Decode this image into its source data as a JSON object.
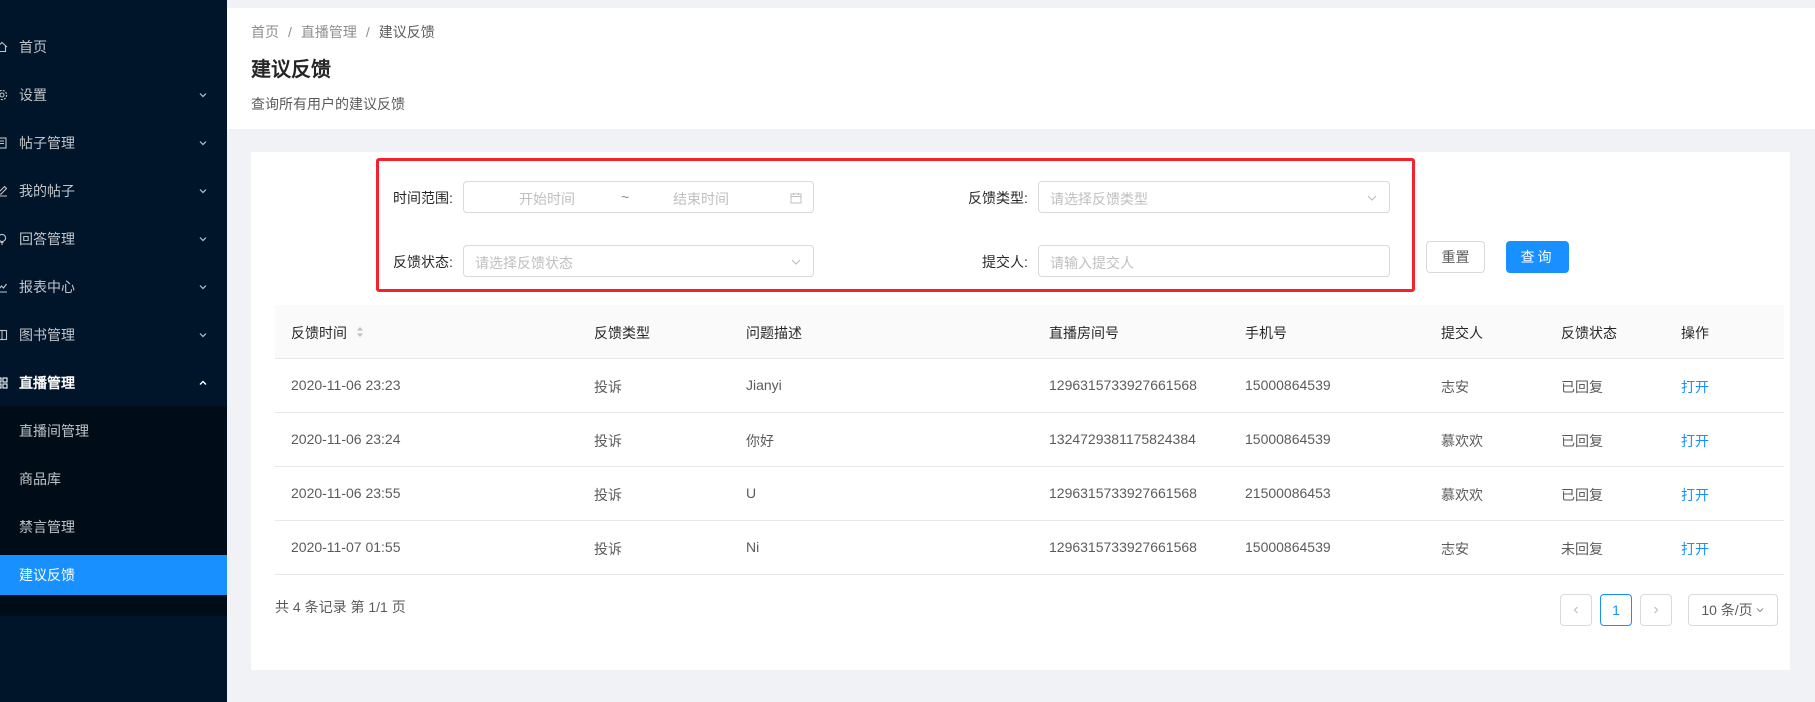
{
  "sidebar": {
    "items": [
      {
        "label": "首页",
        "icon": "home-icon"
      },
      {
        "label": "设置",
        "icon": "gear-icon"
      },
      {
        "label": "帖子管理",
        "icon": "file-icon"
      },
      {
        "label": "我的帖子",
        "icon": "edit-icon"
      },
      {
        "label": "回答管理",
        "icon": "bulb-icon"
      },
      {
        "label": "报表中心",
        "icon": "line-chart-icon"
      },
      {
        "label": "图书管理",
        "icon": "book-icon"
      },
      {
        "label": "直播管理",
        "icon": "appstore-icon"
      }
    ],
    "subitems": [
      {
        "label": "直播间管理"
      },
      {
        "label": "商品库"
      },
      {
        "label": "禁言管理"
      },
      {
        "label": "建议反馈"
      }
    ]
  },
  "header": {
    "breadcrumb": [
      "首页",
      "直播管理",
      "建议反馈"
    ],
    "separator": "/",
    "title": "建议反馈",
    "description": "查询所有用户的建议反馈"
  },
  "filters": {
    "time_range_label": "时间范围:",
    "start_placeholder": "开始时间",
    "range_sep": "~",
    "end_placeholder": "结束时间",
    "type_label": "反馈类型:",
    "type_placeholder": "请选择反馈类型",
    "status_label": "反馈状态:",
    "status_placeholder": "请选择反馈状态",
    "submitter_label": "提交人:",
    "submitter_placeholder": "请输入提交人",
    "reset_label": "重置",
    "query_label": "查询"
  },
  "table": {
    "columns": [
      "反馈时间",
      "反馈类型",
      "问题描述",
      "直播房间号",
      "手机号",
      "提交人",
      "反馈状态",
      "操作"
    ],
    "rows": [
      [
        "2020-11-06 23:23",
        "投诉",
        "Jianyi",
        "1296315733927661568",
        "15000864539",
        "志安",
        "已回复",
        "打开"
      ],
      [
        "2020-11-06 23:24",
        "投诉",
        "你好",
        "1324729381175824384",
        "15000864539",
        "慕欢欢",
        "已回复",
        "打开"
      ],
      [
        "2020-11-06 23:55",
        "投诉",
        "U",
        "1296315733927661568",
        "21500086453",
        "慕欢欢",
        "已回复",
        "打开"
      ],
      [
        "2020-11-07 01:55",
        "投诉",
        "Ni",
        "1296315733927661568",
        "15000864539",
        "志安",
        "未回复",
        "打开"
      ]
    ]
  },
  "pagination": {
    "summary": "共 4 条记录 第 1/1 页",
    "current_page": "1",
    "page_size": "10 条/页"
  },
  "colors": {
    "sidebar_bg": "#001529",
    "submenu_bg": "#000c17",
    "primary": "#1890ff",
    "highlight": "#f5222d"
  }
}
